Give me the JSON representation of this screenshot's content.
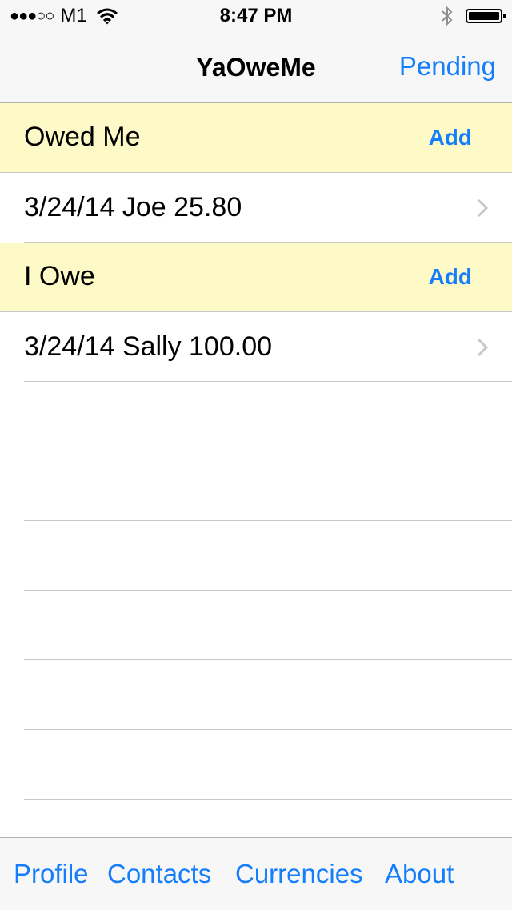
{
  "status_bar": {
    "signal": "●●●○○",
    "carrier": "M1",
    "time": "8:47 PM",
    "icons": [
      "wifi-icon",
      "bluetooth-icon",
      "battery-icon"
    ],
    "battery_level": 1.0
  },
  "nav": {
    "title": "YaOweMe",
    "right_button": "Pending"
  },
  "sections": [
    {
      "title": "Owed Me",
      "add_label": "Add",
      "rows": [
        {
          "text": "3/24/14 Joe 25.80"
        }
      ]
    },
    {
      "title": "I Owe",
      "add_label": "Add",
      "rows": [
        {
          "text": "3/24/14 Sally 100.00"
        }
      ]
    }
  ],
  "toolbar": {
    "items": [
      {
        "label": "Profile"
      },
      {
        "label": "Contacts"
      },
      {
        "label": "Currencies"
      },
      {
        "label": "About"
      }
    ]
  },
  "colors": {
    "accent": "#157efb",
    "section_header_bg": "#fefac8",
    "bar_bg": "#f7f7f7"
  }
}
